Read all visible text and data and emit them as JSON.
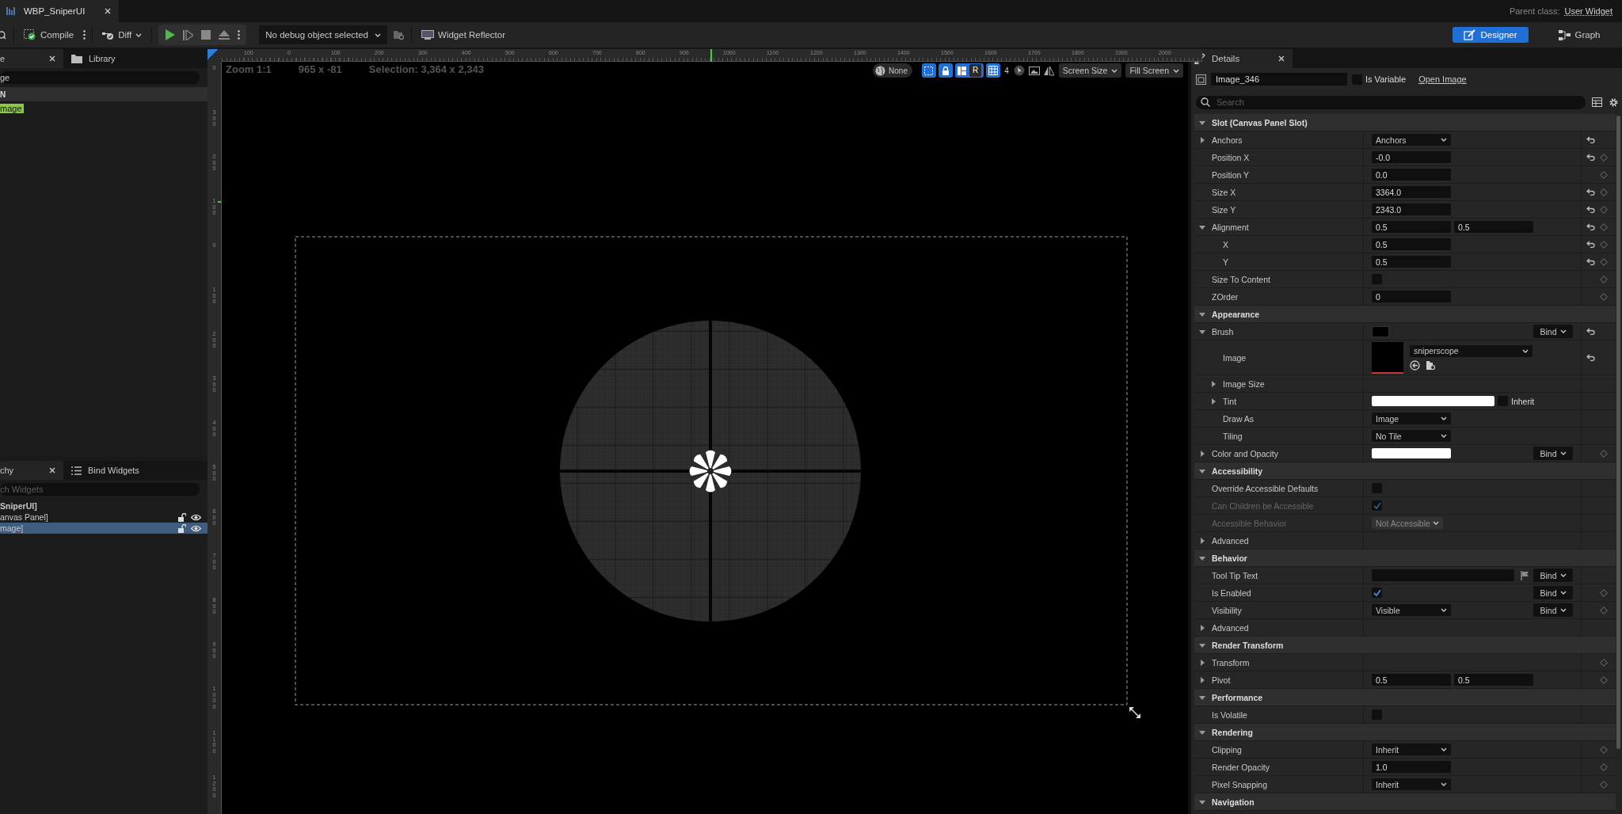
{
  "window": {
    "tab": "WBP_SniperUI",
    "parent_class_label": "Parent class:",
    "parent_class": "User Widget"
  },
  "toolbar": {
    "compile": "Compile",
    "diff": "Diff",
    "debug_dropdown": "No debug object selected",
    "reflector": "Widget Reflector"
  },
  "modes": [
    {
      "label": "Designer",
      "selected": true
    },
    {
      "label": "Graph",
      "selected": false
    }
  ],
  "palette": {
    "tabs": [
      {
        "label": "e",
        "selected": true
      },
      {
        "label": "Library",
        "selected": false
      }
    ],
    "search": "ge",
    "category": "N",
    "items": [
      {
        "label": "mage",
        "matched": true
      }
    ]
  },
  "hierarchy": {
    "tabs": [
      {
        "label": "chy",
        "selected": true
      },
      {
        "label": "Bind Widgets",
        "selected": false
      }
    ],
    "placeholder": "ch Widgets",
    "tree": [
      {
        "label": "SniperUI]",
        "selected": false,
        "children": [
          {
            "label": "anvas Panel]",
            "selected": false,
            "children": [
              {
                "label": "mage]",
                "selected": true
              }
            ]
          }
        ]
      }
    ]
  },
  "ruler": {
    "horizontal": [
      "100",
      "0",
      "100",
      "200",
      "300",
      "400",
      "500",
      "600",
      "700",
      "800",
      "900",
      "1000",
      "1100",
      "1200",
      "1300",
      "1400",
      "1500",
      "1600",
      "1700",
      "1800",
      "1900",
      "2000"
    ],
    "vertical": [
      "0",
      "300",
      "200",
      "100",
      "0",
      "100",
      "200",
      "300",
      "400",
      "500",
      "600",
      "700",
      "800",
      "900",
      "1000",
      "1100",
      "1200"
    ]
  },
  "viewport": {
    "zoom": "Zoom 1:1",
    "cursor": "965 x -81",
    "selection": "Selection: 3,364 x 2,343",
    "localization": "None",
    "toggles": [
      {
        "kind": "marquee",
        "on": true
      },
      {
        "kind": "lock",
        "on": true
      },
      {
        "kind": "respect",
        "label": "R",
        "on": true
      },
      {
        "kind": "grid",
        "on": true
      }
    ],
    "grid_size": "4",
    "screen_size": "Screen Size",
    "fill": "Fill Screen"
  },
  "details": {
    "tab": "Details",
    "name": "Image_346",
    "is_variable": {
      "label": "Is Variable",
      "checked": false
    },
    "open_link": "Open Image",
    "search_placeholder": "Search",
    "sections": [
      {
        "title": "Slot (Canvas Panel Slot)",
        "expanded": true,
        "rows": [
          {
            "label": "Anchors",
            "expanded": false,
            "kind": "dropdown",
            "value": "Anchors",
            "reset": true,
            "keyable": false,
            "disabled": false
          },
          {
            "label": "Position X",
            "kind": "field",
            "value": "-0.0",
            "reset": true,
            "keyable": true,
            "disabled": false
          },
          {
            "label": "Position Y",
            "kind": "field",
            "value": "0.0",
            "reset": false,
            "keyable": true,
            "disabled": false
          },
          {
            "label": "Size X",
            "kind": "field",
            "value": "3364.0",
            "reset": true,
            "keyable": true,
            "disabled": false
          },
          {
            "label": "Size Y",
            "kind": "field",
            "value": "2343.0",
            "reset": true,
            "keyable": true,
            "disabled": false
          },
          {
            "label": "Alignment",
            "expanded": true,
            "kind": "pair",
            "values": [
              "0.5",
              "0.5"
            ],
            "reset": true,
            "keyable": true,
            "disabled": false,
            "children": [
              {
                "label": "X",
                "kind": "field",
                "value": "0.5",
                "reset": true,
                "keyable": true,
                "disabled": false
              },
              {
                "label": "Y",
                "kind": "field",
                "value": "0.5",
                "reset": true,
                "keyable": true,
                "disabled": false
              }
            ]
          },
          {
            "label": "Size To Content",
            "kind": "checkbox",
            "checked": false,
            "reset": false,
            "keyable": true,
            "disabled": false
          },
          {
            "label": "ZOrder",
            "kind": "field",
            "value": "0",
            "reset": false,
            "keyable": true,
            "disabled": false
          }
        ]
      },
      {
        "title": "Appearance",
        "expanded": true,
        "rows": [
          {
            "label": "Brush",
            "expanded": true,
            "kind": "swatch",
            "color": "#000000",
            "bind": "Bind",
            "reset": true,
            "keyable": false,
            "disabled": false,
            "children": [
              {
                "label": "Image",
                "kind": "asset",
                "value": "sniperscope",
                "reset": true,
                "keyable": false,
                "disabled": false
              },
              {
                "label": "Image Size",
                "expanded": false,
                "kind": "none",
                "reset": false,
                "keyable": false,
                "disabled": false
              },
              {
                "label": "Tint",
                "expanded": false,
                "kind": "color",
                "color": "#ffffff",
                "inherit": {
                  "label": "Inherit",
                  "checked": false
                },
                "reset": false,
                "keyable": false,
                "disabled": false
              },
              {
                "label": "Draw As",
                "kind": "dropdown",
                "value": "Image",
                "reset": false,
                "keyable": false,
                "disabled": false
              },
              {
                "label": "Tiling",
                "kind": "dropdown",
                "value": "No Tile",
                "reset": false,
                "keyable": false,
                "disabled": false
              }
            ]
          },
          {
            "label": "Color and Opacity",
            "expanded": false,
            "kind": "color",
            "color": "#ffffff",
            "bind": "Bind",
            "reset": false,
            "keyable": true,
            "disabled": false
          }
        ]
      },
      {
        "title": "Accessibility",
        "expanded": true,
        "rows": [
          {
            "label": "Override Accessible Defaults",
            "kind": "checkbox",
            "checked": false,
            "reset": false,
            "keyable": false,
            "disabled": false
          },
          {
            "label": "Can Children be Accessible",
            "kind": "checkbox",
            "checked": true,
            "reset": false,
            "keyable": false,
            "disabled": true
          },
          {
            "label": "Accessible Behavior",
            "kind": "dropdown",
            "value": "Not Accessible",
            "reset": false,
            "keyable": false,
            "disabled": true
          },
          {
            "label": "Advanced",
            "expanded": false,
            "kind": "none",
            "reset": false,
            "keyable": false,
            "disabled": false
          }
        ]
      },
      {
        "title": "Behavior",
        "expanded": true,
        "rows": [
          {
            "label": "Tool Tip Text",
            "kind": "text",
            "bind": "Bind",
            "reset": false,
            "keyable": false,
            "disabled": false
          },
          {
            "label": "Is Enabled",
            "kind": "checkbox",
            "checked": true,
            "bind": "Bind",
            "reset": false,
            "keyable": true,
            "disabled": false
          },
          {
            "label": "Visibility",
            "kind": "dropdown",
            "value": "Visible",
            "bind": "Bind",
            "reset": false,
            "keyable": true,
            "disabled": false
          },
          {
            "label": "Advanced",
            "expanded": false,
            "kind": "none",
            "reset": false,
            "keyable": false,
            "disabled": false
          }
        ]
      },
      {
        "title": "Render Transform",
        "expanded": true,
        "rows": [
          {
            "label": "Transform",
            "expanded": false,
            "kind": "none",
            "reset": false,
            "keyable": true,
            "disabled": false
          },
          {
            "label": "Pivot",
            "expanded": false,
            "kind": "pair",
            "values": [
              "0.5",
              "0.5"
            ],
            "reset": false,
            "keyable": true,
            "disabled": false
          }
        ]
      },
      {
        "title": "Performance",
        "expanded": true,
        "rows": [
          {
            "label": "Is Volatile",
            "kind": "checkbox",
            "checked": false,
            "reset": false,
            "keyable": false,
            "disabled": false
          }
        ]
      },
      {
        "title": "Rendering",
        "expanded": true,
        "rows": [
          {
            "label": "Clipping",
            "kind": "dropdown",
            "value": "Inherit",
            "reset": false,
            "keyable": true,
            "disabled": false
          },
          {
            "label": "Render Opacity",
            "kind": "field",
            "value": "1.0",
            "reset": false,
            "keyable": true,
            "disabled": false
          },
          {
            "label": "Pixel Snapping",
            "kind": "dropdown",
            "value": "Inherit",
            "reset": false,
            "keyable": true,
            "disabled": false
          }
        ]
      },
      {
        "title": "Navigation",
        "expanded": true
      }
    ]
  }
}
